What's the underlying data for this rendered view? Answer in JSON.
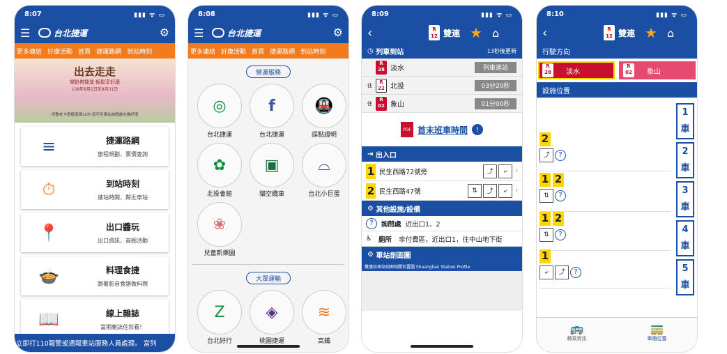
{
  "status": {
    "s1": "8:07",
    "s2": "8:08",
    "s3": "8:09",
    "s4": "8:10",
    "icons": "▮▮▮ ᯤ ▭"
  },
  "brand": {
    "logo_text": "台北捷運"
  },
  "tabs": [
    "更多連結",
    "好康活動",
    "首頁",
    "捷運路網",
    "到站時刻"
  ],
  "banner": {
    "title": "出去走走",
    "subtitle": "樂齡搭捷運 輕鬆享好康",
    "date": "108年8月1日至8月31日",
    "note": "持敬老卡搭捷運滿10次 即可至車站詢問處兌換好禮"
  },
  "menu": [
    {
      "title": "捷運路網",
      "sub": "旅程規劃、票價查詢",
      "icon": "≡"
    },
    {
      "title": "到站時刻",
      "sub": "進站時間、鄰近車站",
      "icon": "⏱"
    },
    {
      "title": "出口醬玩",
      "sub": "出口資訊、商圈活動",
      "icon": "📍"
    },
    {
      "title": "料理食捷",
      "sub": "跟著影音食譜做料理",
      "icon": "🍲"
    },
    {
      "title": "線上雜誌",
      "sub": "當期雜誌任您看！",
      "icon": "📖"
    }
  ],
  "ticker": "立即打110報警或通報車站服務人員處理。 當列",
  "services": {
    "title": "營運服務",
    "items": [
      "台北捷運",
      "台北捷運",
      "誤點證明",
      "北投會館",
      "貓空纜車",
      "台北小巨蛋",
      "兒童新樂園"
    ]
  },
  "transport": {
    "title": "大眾運輸",
    "items": [
      "台北好行",
      "桃園捷運",
      "高鐵"
    ]
  },
  "station": {
    "code_top": "R",
    "code_num": "12",
    "name": "雙連"
  },
  "arrivals": {
    "title": "列車到站",
    "refresh": "13秒後更新",
    "rows": [
      {
        "code": "R",
        "num": "28",
        "dest": "淡水",
        "status": "列車進站",
        "to": ""
      },
      {
        "code": "R",
        "num": "22",
        "dest": "北投",
        "status": "03分20秒",
        "to": "往"
      },
      {
        "code": "R",
        "num": "02",
        "dest": "象山",
        "status": "01分00秒",
        "to": "往"
      }
    ]
  },
  "pdf": {
    "icon": "PDF",
    "link": "首末班車時間",
    "info": "!"
  },
  "exits": {
    "title": "出入口",
    "rows": [
      {
        "num": "1",
        "name": "民生西路72號旁"
      },
      {
        "num": "2",
        "name": "民生西路47號"
      }
    ]
  },
  "facilities": {
    "title": "其他設施/設備",
    "rows": [
      {
        "icon": "?",
        "name": "詢問處",
        "desc": "近出口1、2"
      },
      {
        "icon": "♿",
        "name": "廁所",
        "desc": "非付費區，近出口1，往中山地下街"
      }
    ]
  },
  "profile": {
    "title": "車站剖面圖",
    "header": "雙連站車站剖面相關位置圖 Shuanglian Station Profile"
  },
  "direction": {
    "title": "行駛方向",
    "buttons": [
      {
        "code": "R",
        "num": "28",
        "name": "淡水"
      },
      {
        "code": "R",
        "num": "02",
        "name": "象山"
      }
    ]
  },
  "cars": {
    "title": "設施位置",
    "labels": [
      "1\n車",
      "2\n車",
      "3\n車",
      "4\n車",
      "5\n車"
    ],
    "rows": [
      [
        "2"
      ],
      [
        "1",
        "2"
      ],
      [
        "1",
        "2"
      ],
      [
        "1"
      ]
    ]
  },
  "bottomnav": {
    "a": "轉乘資訊",
    "b": "車廂位置"
  }
}
